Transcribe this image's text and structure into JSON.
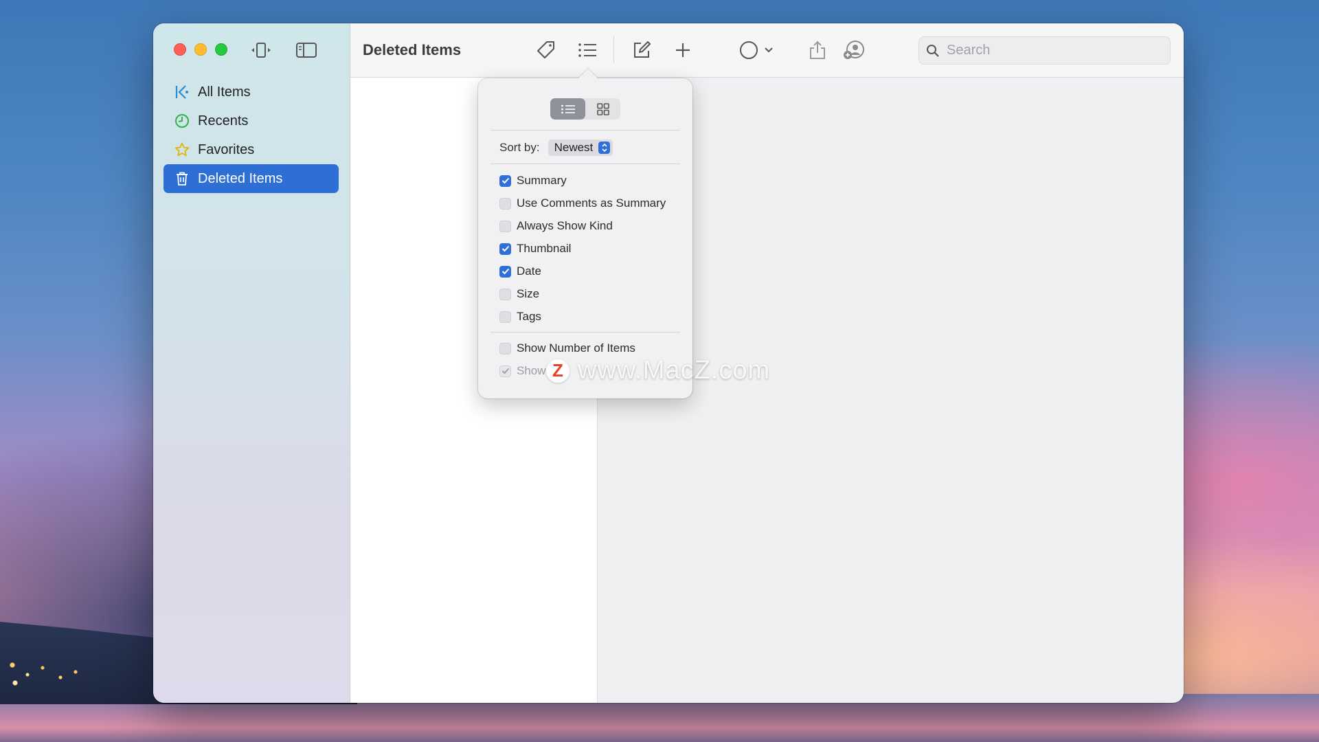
{
  "app": {
    "title": "Deleted Items"
  },
  "sidebar": {
    "items": [
      {
        "label": "All Items",
        "icon": "all-items-icon"
      },
      {
        "label": "Recents",
        "icon": "clock-icon"
      },
      {
        "label": "Favorites",
        "icon": "star-icon"
      },
      {
        "label": "Deleted Items",
        "icon": "trash-icon",
        "selected": true
      }
    ]
  },
  "toolbar": {
    "search_placeholder": "Search"
  },
  "view_options": {
    "sort_label": "Sort by:",
    "sort_value": "Newest",
    "view_mode_selected": "list",
    "options": [
      {
        "label": "Summary",
        "checked": true
      },
      {
        "label": "Use Comments as Summary",
        "checked": false
      },
      {
        "label": "Always Show Kind",
        "checked": false
      },
      {
        "label": "Thumbnail",
        "checked": true
      },
      {
        "label": "Date",
        "checked": true
      },
      {
        "label": "Size",
        "checked": false
      },
      {
        "label": "Tags",
        "checked": false
      }
    ],
    "extra": [
      {
        "label": "Show Number of Items",
        "checked": false
      },
      {
        "label": "Show",
        "checked": true,
        "disabled": true
      }
    ]
  },
  "watermark": {
    "badge": "Z",
    "text": "www.MacZ.com"
  },
  "colors": {
    "accent": "#2e6fd6",
    "close": "#fe5f57",
    "minimize": "#febc2e",
    "zoom": "#28c840"
  }
}
